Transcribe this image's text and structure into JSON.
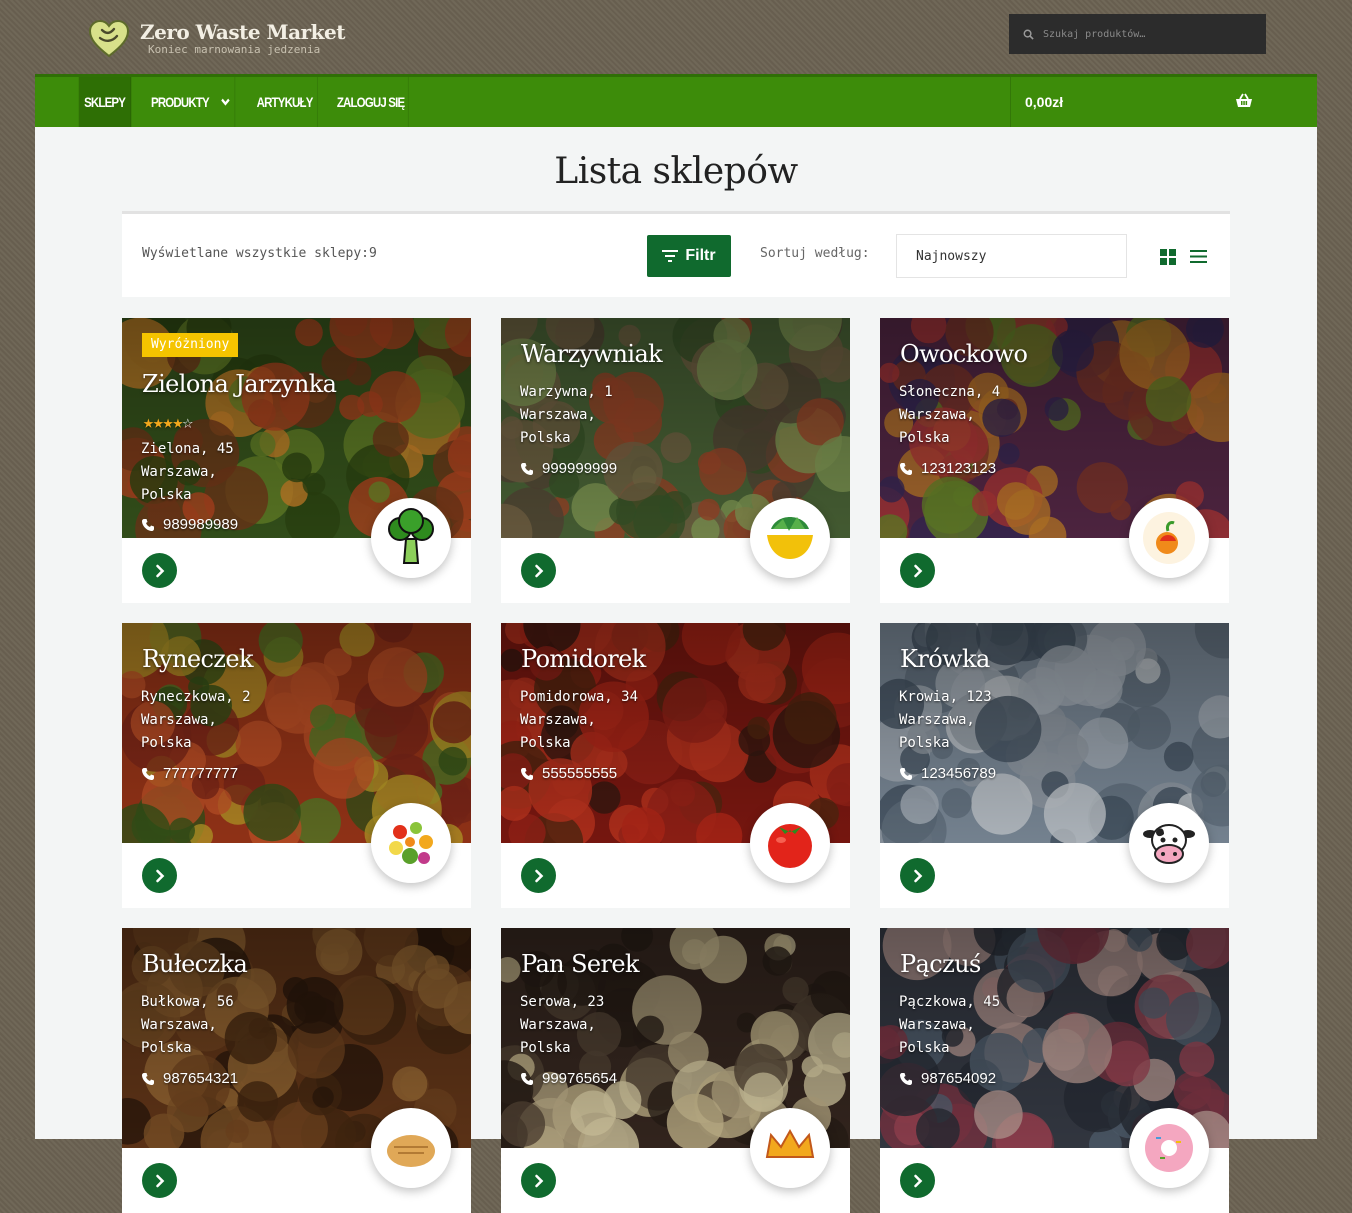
{
  "site": {
    "title": "Zero Waste Market",
    "subtitle": "Koniec marnowania jedzenia"
  },
  "search": {
    "placeholder": "Szukaj produktów…"
  },
  "nav": {
    "items": [
      {
        "label": "SKLEPY",
        "active": true
      },
      {
        "label": "PRODUKTY",
        "has_dropdown": true
      },
      {
        "label": "ARTYKUŁY"
      },
      {
        "label": "ZALOGUJ SIĘ"
      }
    ],
    "cart_total": "0,00zł"
  },
  "page": {
    "title": "Lista sklepów"
  },
  "toolbar": {
    "count_label": "Wyświetlane wszystkie sklepy:9",
    "filter_label": "Filtr",
    "sort_label": "Sortuj według:",
    "sort_value": "Najnowszy",
    "view_modes": [
      "grid-view-icon",
      "list-view-icon"
    ]
  },
  "colors": {
    "nav_green": "#3d8c0a",
    "action_green": "#106a2e",
    "badge_yellow": "#f5c400",
    "star": "#f2a81d"
  },
  "stores": [
    {
      "name": "Zielona Jarzynka",
      "featured_label": "Wyróżniony",
      "rating": 4,
      "rating_max": 5,
      "street": "Zielona, 45",
      "city": "Warszawa,",
      "country": "Polska",
      "phone": "989989989",
      "logo_icon": "broccoli-icon"
    },
    {
      "name": "Warzywniak",
      "street": "Warzywna, 1",
      "city": "Warszawa,",
      "country": "Polska",
      "phone": "999999999",
      "logo_icon": "salad-bowl-icon"
    },
    {
      "name": "Owockowo",
      "street": "Słoneczna, 4",
      "city": "Warszawa,",
      "country": "Polska",
      "phone": "123123123",
      "logo_icon": "fruit-icon"
    },
    {
      "name": "Ryneczek",
      "street": "Ryneczkowa, 2",
      "city": "Warszawa,",
      "country": "Polska",
      "phone": "777777777",
      "logo_icon": "fruit-basket-icon"
    },
    {
      "name": "Pomidorek",
      "street": "Pomidorowa, 34",
      "city": "Warszawa,",
      "country": "Polska",
      "phone": "555555555",
      "logo_icon": "tomato-icon"
    },
    {
      "name": "Krówka",
      "street": "Krowia, 123",
      "city": "Warszawa,",
      "country": "Polska",
      "phone": "123456789",
      "logo_icon": "cow-icon"
    },
    {
      "name": "Bułeczka",
      "street": "Bułkowa, 56",
      "city": "Warszawa,",
      "country": "Polska",
      "phone": "987654321",
      "logo_icon": "bread-icon"
    },
    {
      "name": "Pan Serek",
      "street": "Serowa, 23",
      "city": "Warszawa,",
      "country": "Polska",
      "phone": "999765654",
      "logo_icon": "cheese-crown-icon"
    },
    {
      "name": "Pączuś",
      "street": "Pączkowa, 45",
      "city": "Warszawa,",
      "country": "Polska",
      "phone": "987654092",
      "logo_icon": "donut-icon"
    }
  ]
}
